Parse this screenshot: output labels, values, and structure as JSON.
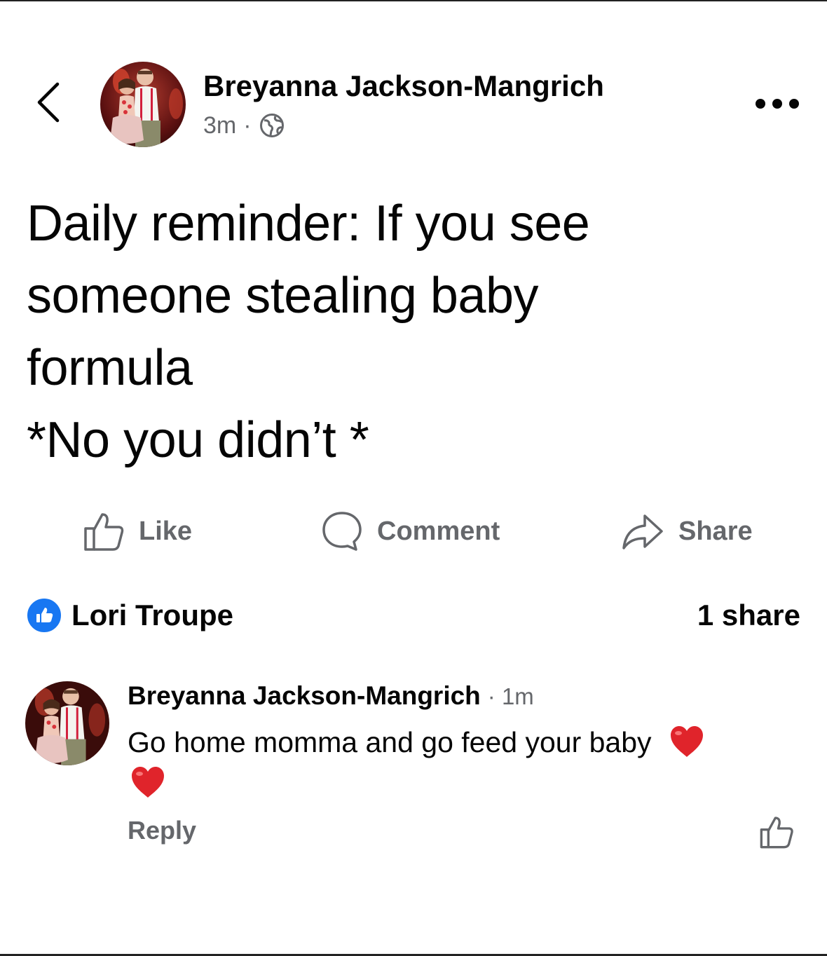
{
  "post": {
    "author": "Breyanna Jackson-Mangrich",
    "time": "3m",
    "separator": "·",
    "privacy_icon": "globe-icon",
    "text_lines": [
      "Daily reminder: If you see",
      "someone stealing baby",
      "formula",
      "*No you didn’t *"
    ]
  },
  "actions": {
    "like": "Like",
    "comment": "Comment",
    "share": "Share"
  },
  "reactions": {
    "icon": "like-icon",
    "name": "Lori Troupe",
    "share_count": "1 share"
  },
  "comment": {
    "author": "Breyanna Jackson-Mangrich",
    "time": "· 1m",
    "text": "Go home momma and go feed your baby",
    "emoji": "red-heart",
    "reply": "Reply"
  },
  "colors": {
    "accent": "#1877f2",
    "secondary_text": "#65676b",
    "heart": "#e0242b"
  }
}
